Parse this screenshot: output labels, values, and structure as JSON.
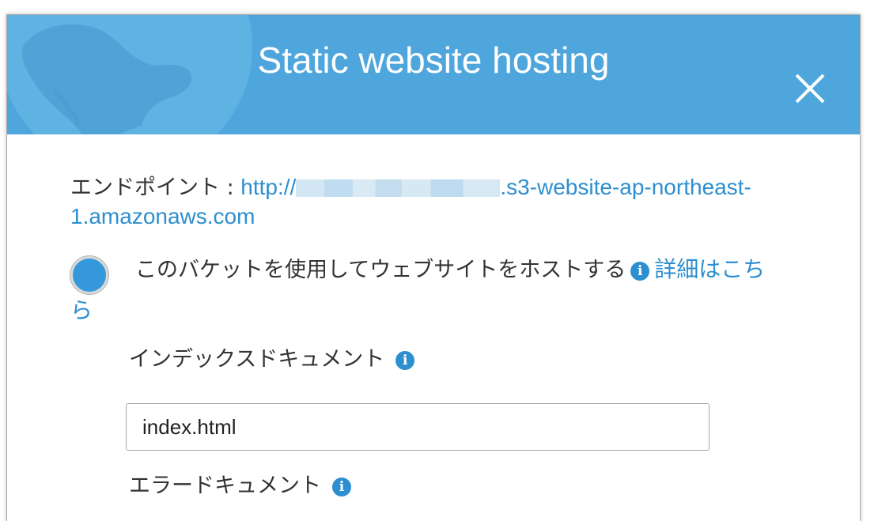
{
  "dialog": {
    "title": "Static website hosting",
    "close_icon": "close-icon",
    "endpoint_label": "エンドポイント : ",
    "endpoint_prefix": "http://",
    "endpoint_suffix": ".s3-website-ap-northeast-",
    "endpoint_suffix2": "1.amazonaws.com",
    "host_option_label": "このバケットを使用してウェブサイトをホストする",
    "learn_more_part1": "詳細はこち",
    "learn_more_part2": "ら",
    "index_document_label": "インデックスドキュメント",
    "index_document_value": "index.html",
    "error_document_label": "エラードキュメント",
    "info_icon": "info-icon",
    "colors": {
      "header": "#4ea6dc",
      "link": "#2d8fcf",
      "radio": "#3498db"
    }
  }
}
